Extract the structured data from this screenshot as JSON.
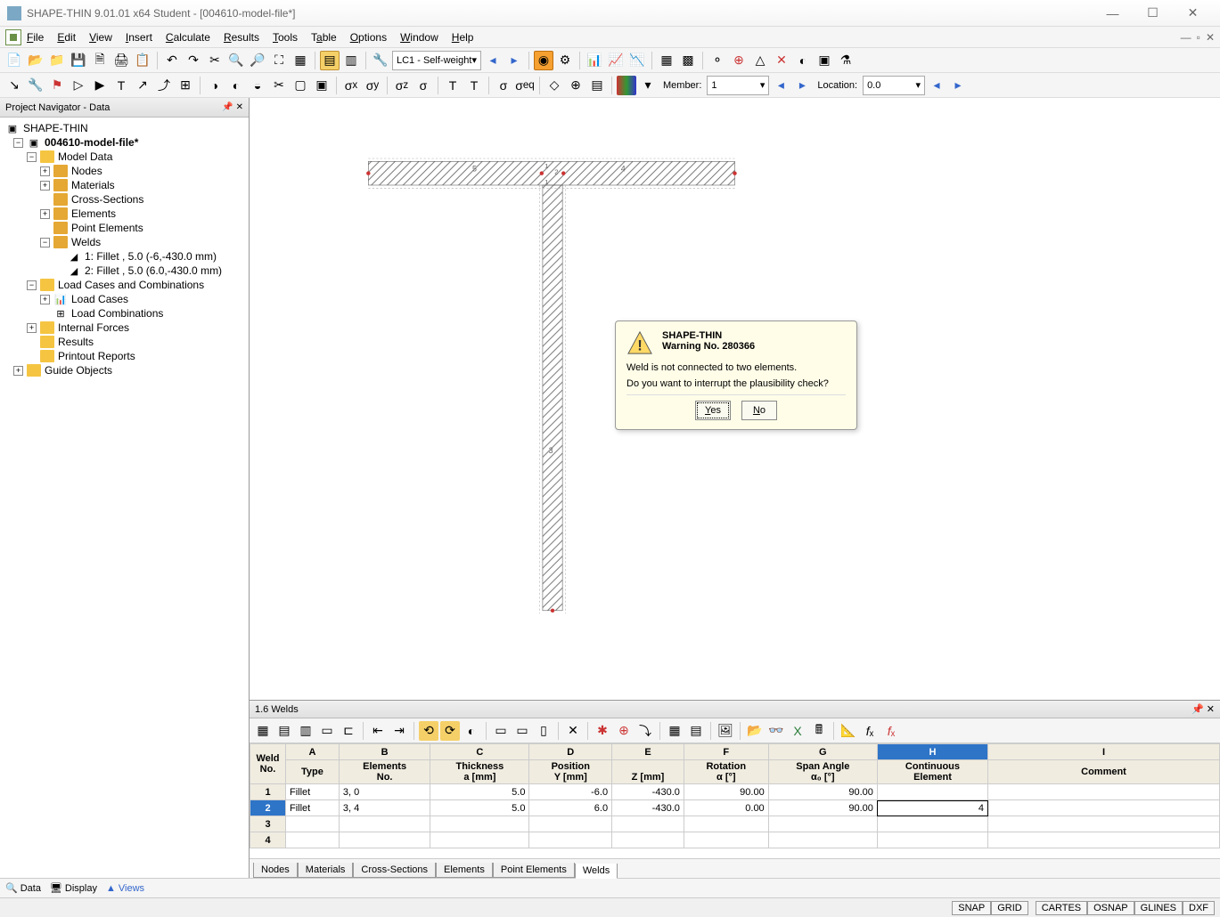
{
  "title": "SHAPE-THIN 9.01.01 x64 Student - [004610-model-file*]",
  "menu": {
    "file": "File",
    "edit": "Edit",
    "view": "View",
    "insert": "Insert",
    "calculate": "Calculate",
    "results": "Results",
    "tools": "Tools",
    "table": "Table",
    "options": "Options",
    "window": "Window",
    "help": "Help"
  },
  "toolbar1": {
    "loadcase_selector": "LC1 - Self-weight",
    "member_label": "Member:",
    "member_value": "1",
    "location_label": "Location:",
    "location_value": "0.0"
  },
  "nav": {
    "panel_title": "Project Navigator - Data",
    "root": "SHAPE-THIN",
    "project": "004610-model-file*",
    "model_data": "Model Data",
    "nodes": "Nodes",
    "materials": "Materials",
    "cross_sections": "Cross-Sections",
    "elements": "Elements",
    "point_elements": "Point Elements",
    "welds": "Welds",
    "weld1": "1: Fillet , 5.0 (-6,-430.0 mm)",
    "weld2": "2: Fillet , 5.0 (6.0,-430.0 mm)",
    "load_combos": "Load Cases and Combinations",
    "load_cases": "Load Cases",
    "load_combinations": "Load Combinations",
    "internal_forces": "Internal Forces",
    "results": "Results",
    "printout": "Printout Reports",
    "guide": "Guide Objects",
    "tab_data": "Data",
    "tab_display": "Display",
    "tab_views": "Views"
  },
  "dialog": {
    "title": "SHAPE-THIN",
    "subtitle": "Warning No. 280366",
    "line1": "Weld is not connected to two elements.",
    "line2": "Do you want to interrupt the plausibility check?",
    "yes": "Yes",
    "no": "No"
  },
  "bottom": {
    "title": "1.6 Welds",
    "cols": {
      "A": "A",
      "B": "B",
      "C": "C",
      "D": "D",
      "E": "E",
      "F": "F",
      "G": "G",
      "H": "H",
      "I": "I"
    },
    "head": {
      "weld": "Weld",
      "no": "No.",
      "type": "Type",
      "elements": "Elements",
      "eno": "No.",
      "thickness": "Thickness",
      "amm": "a [mm]",
      "position": "Position",
      "ymm": "Y [mm]",
      "zmm": "Z [mm]",
      "rotation": "Rotation",
      "alpha": "α [°]",
      "span": "Span Angle",
      "alpha0": "α₀ [°]",
      "continuous": "Continuous",
      "element": "Element",
      "comment": "Comment"
    },
    "rows": [
      {
        "no": "1",
        "type": "Fillet",
        "elem": "3, 0",
        "thick": "5.0",
        "y": "-6.0",
        "z": "-430.0",
        "rot": "90.00",
        "span": "90.00",
        "cont": "",
        "comment": ""
      },
      {
        "no": "2",
        "type": "Fillet",
        "elem": "3, 4",
        "thick": "5.0",
        "y": "6.0",
        "z": "-430.0",
        "rot": "0.00",
        "span": "90.00",
        "cont": "4",
        "comment": ""
      },
      {
        "no": "3",
        "type": "",
        "elem": "",
        "thick": "",
        "y": "",
        "z": "",
        "rot": "",
        "span": "",
        "cont": "",
        "comment": ""
      },
      {
        "no": "4",
        "type": "",
        "elem": "",
        "thick": "",
        "y": "",
        "z": "",
        "rot": "",
        "span": "",
        "cont": "",
        "comment": ""
      }
    ],
    "tabs": {
      "nodes": "Nodes",
      "materials": "Materials",
      "cross": "Cross-Sections",
      "elements": "Elements",
      "point": "Point Elements",
      "welds": "Welds"
    }
  },
  "statusbar": {
    "snap": "SNAP",
    "grid": "GRID",
    "cartes": "CARTES",
    "osnap": "OSNAP",
    "glines": "GLINES",
    "dxf": "DXF"
  }
}
